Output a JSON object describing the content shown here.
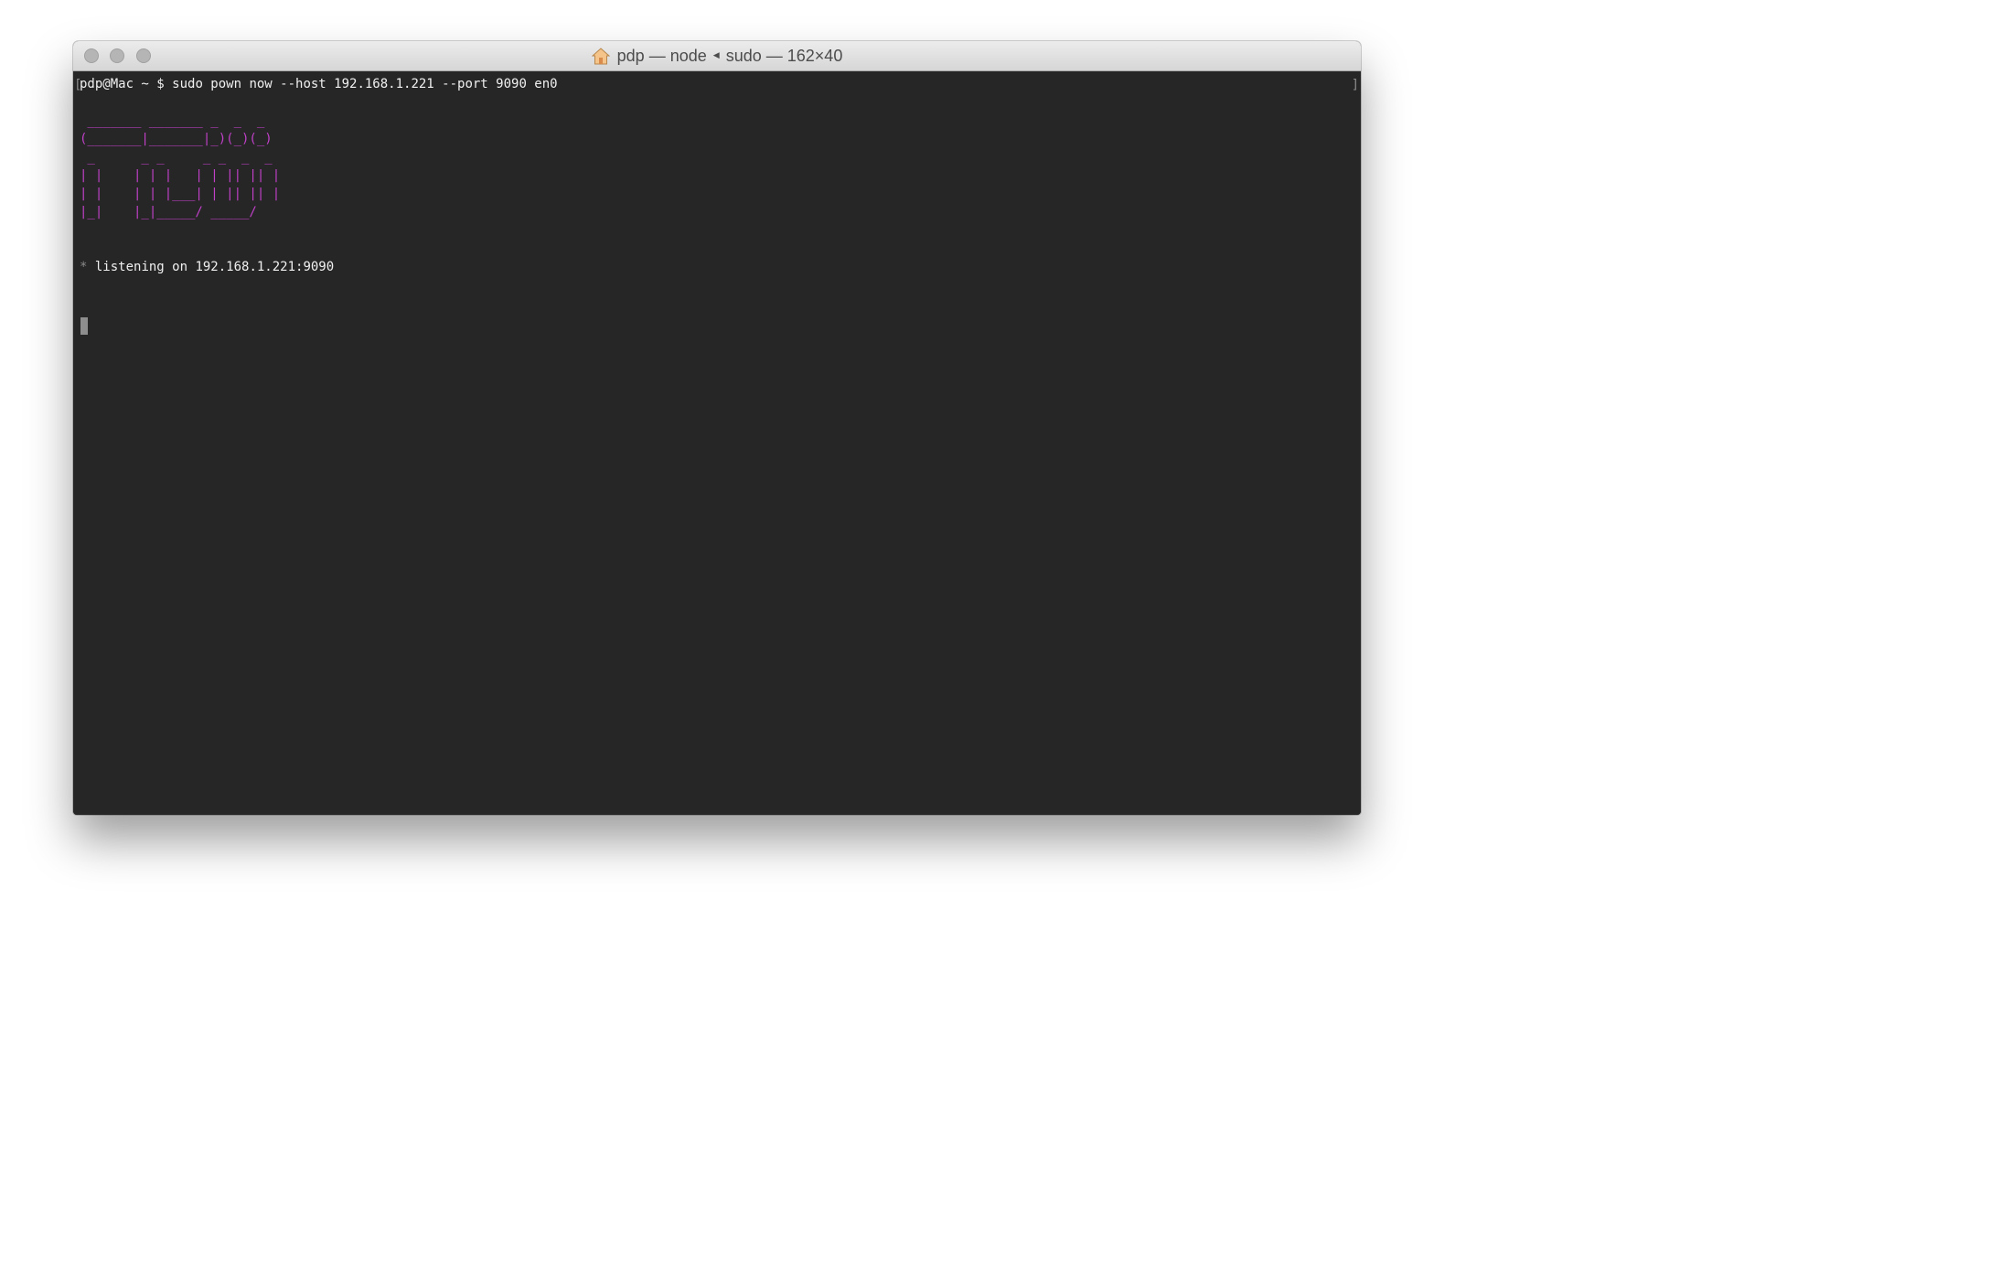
{
  "window": {
    "title_user": "pdp",
    "title_sep1": "—",
    "title_process": "node",
    "title_process2": "sudo",
    "title_sep2": "—",
    "title_size": "162×40"
  },
  "terminal": {
    "prompt": "pdp@Mac ~ $ ",
    "command": "sudo pown now --host 192.168.1.221 --port 9090 en0",
    "banner_color": "#c040c8",
    "banner_lines": [
      " _______ _______ _  _  _ ",
      "(_______|_______|_)(_)(_)",
      " _      _ _     _ _  _  _ ",
      "| |    | | |   | | || || |",
      "| |    | | |___| | || || |",
      "|_|    |_|_____/ _____/ "
    ],
    "status_marker": "*",
    "status_text": " listening on 192.168.1.221:9090"
  }
}
